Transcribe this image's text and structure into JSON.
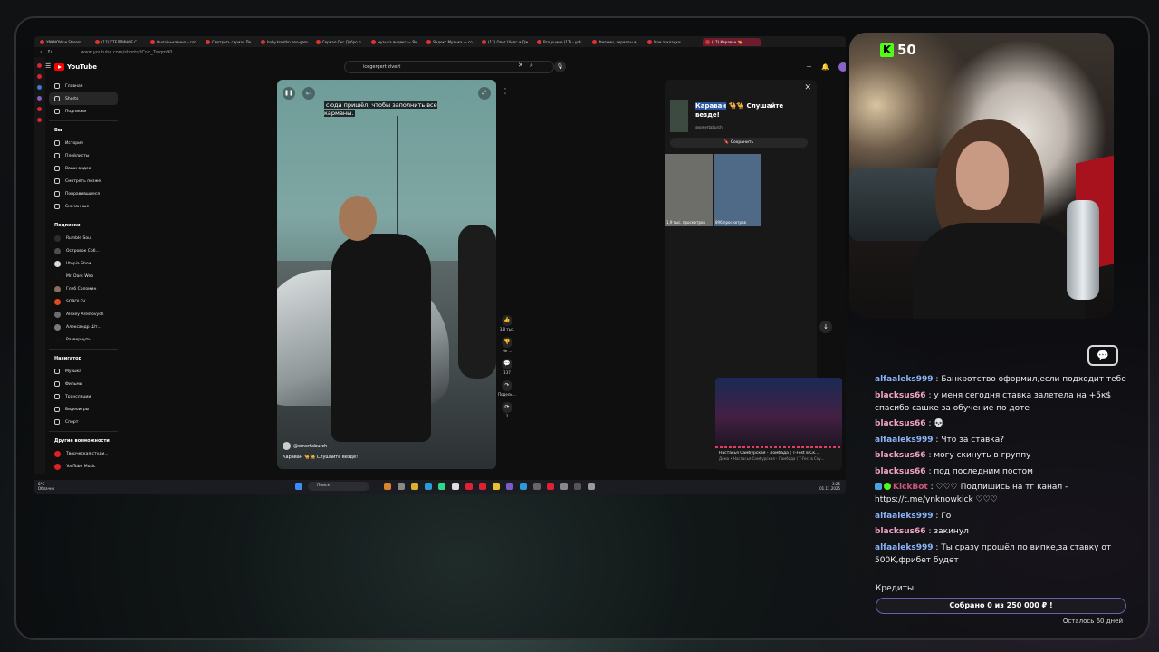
{
  "browser": {
    "tabs": [
      {
        "label": "YNKNOWne Stream",
        "active": false
      },
      {
        "label": "(17) СТЕЛЛИНОЕ С",
        "active": false
      },
      {
        "label": "Онлайн-казино – сло",
        "active": false
      },
      {
        "label": "Смотреть сериал Пе",
        "active": false
      },
      {
        "label": "baby.kreatkn.eno-gam",
        "active": false
      },
      {
        "label": "Сериал Окс Добро п",
        "active": false
      },
      {
        "label": "музыка яндекс — Яи",
        "active": false
      },
      {
        "label": "Яндекс Музыка — со",
        "active": false
      },
      {
        "label": "(17) Олег Шепс и Дж",
        "active": false
      },
      {
        "label": "Вгодщине (17) - ynk",
        "active": false
      },
      {
        "label": "Фильмы, сериалы и",
        "active": false
      },
      {
        "label": "Мои закладки",
        "active": false
      },
      {
        "label": "(17) Караван 🐪",
        "active": true
      }
    ],
    "url": "www.youtube.com/shorts/tCr-c_7wqm90"
  },
  "youtube": {
    "logo": "YouTube",
    "search_value": "icegergert zivert",
    "sidebar": {
      "main": [
        {
          "label": "Главная",
          "active": false
        },
        {
          "label": "Shorts",
          "active": true
        },
        {
          "label": "Подписки",
          "active": false
        }
      ],
      "you_heading": "Вы",
      "you": [
        "История",
        "Плейлисты",
        "Ваши видео",
        "Смотреть позже",
        "Понравившиеся",
        "Скачанные"
      ],
      "subs_heading": "Подписки",
      "subs": [
        {
          "label": "Rumble Soul",
          "color": "#2c2c2c"
        },
        {
          "label": "Островок Соб...",
          "color": "#4f4f4f"
        },
        {
          "label": "Utopia Show",
          "color": "#d9d9d9"
        },
        {
          "label": "Mr. Dark Web",
          "color": "#111111"
        },
        {
          "label": "Глеб Соломин",
          "color": "#8a6d5a"
        },
        {
          "label": "SOBOLEV",
          "color": "#e34a1f"
        },
        {
          "label": "Alexey Arestovych",
          "color": "#6d6d6d"
        },
        {
          "label": "Александр Шт...",
          "color": "#7b7b7b"
        },
        {
          "label": "Развернуть",
          "color": "#111111"
        }
      ],
      "nav_heading": "Навигатор",
      "nav": [
        "Музыка",
        "Фильмы",
        "Трансляции",
        "Видеоигры",
        "Спорт"
      ],
      "more_heading": "Другие возможности",
      "more": [
        {
          "label": "Творческая студи...",
          "color": "#e02020"
        },
        {
          "label": "YouTube Music",
          "color": "#e02020"
        }
      ]
    },
    "short": {
      "caption": "сюда пришёл, чтобы заполнить все карманы.",
      "channel": "@omertaburch",
      "title": "Караван 🐪🐪 Слушайте везде!",
      "actions": [
        {
          "icon": "like-icon",
          "glyph": "👍",
          "label": "3,8 тыс."
        },
        {
          "icon": "dislike-icon",
          "glyph": "👎",
          "label": "Не ..."
        },
        {
          "icon": "comments-icon",
          "glyph": "💬",
          "label": "137"
        },
        {
          "icon": "share-icon",
          "glyph": "↷",
          "label": "Подели..."
        },
        {
          "icon": "remix-icon",
          "glyph": "⟳",
          "label": "2"
        }
      ]
    },
    "right_panel": {
      "title_highlight": "Караван",
      "title_rest": " 🐪🐪 Слушайте везде!",
      "channel": "@omertaburch",
      "save_label": "Сохранить",
      "thumbs": [
        {
          "views": "1,9 тыс. просмотров",
          "color": "#6d6e6a"
        },
        {
          "views": "896 просмотров",
          "color": "#4e6a86"
        }
      ]
    },
    "miniplayer": {
      "title": "Настасья Самбурская - Ломбада ( T-Fest в Ск...",
      "subtitle": "Дома • Настасья Самбурская - Ламбада ( T-Fest в Ску..."
    }
  },
  "taskbar": {
    "weather_temp": "8°C",
    "weather_desc": "Облачно",
    "search_placeholder": "Поиск",
    "time": "3:25",
    "date": "01.11.2025"
  },
  "stream": {
    "viewer_count": "50",
    "brand_color": "#53fc18",
    "chat": [
      {
        "user": "alfaaleks999",
        "text": "Банкротство оформил,если подходит тебе",
        "color": "blue"
      },
      {
        "user": "blacksus66",
        "text": "у меня сегодня ставка залетела на +5к$ спасибо сашке за обучение по доте",
        "color": "pink"
      },
      {
        "user": "blacksus66",
        "text": "💀",
        "color": "pink"
      },
      {
        "user": "alfaaleks999",
        "text": "Что за ставка?",
        "color": "blue"
      },
      {
        "user": "blacksus66",
        "text": "могу скинуть в группу",
        "color": "pink"
      },
      {
        "user": "blacksus66",
        "text": "под последним постом",
        "color": "pink"
      },
      {
        "user": "KickBot",
        "text": "♡♡♡ Подпишись на тг канал - https://t.me/ynknowkick ♡♡♡",
        "color": "bot"
      },
      {
        "user": "alfaaleks999",
        "text": "Го",
        "color": "blue"
      },
      {
        "user": "blacksus66",
        "text": "закинул",
        "color": "pink"
      },
      {
        "user": "alfaaleks999",
        "text": "Ты сразу прошёл по випке,за ставку от 500К,фрибет будет",
        "color": "blue"
      }
    ],
    "credits_label": "Кредиты",
    "credits_text": "Собрано 0  из 250 000 ₽ !",
    "credits_progress": 0,
    "days_left": "Осталось 60 дней"
  }
}
